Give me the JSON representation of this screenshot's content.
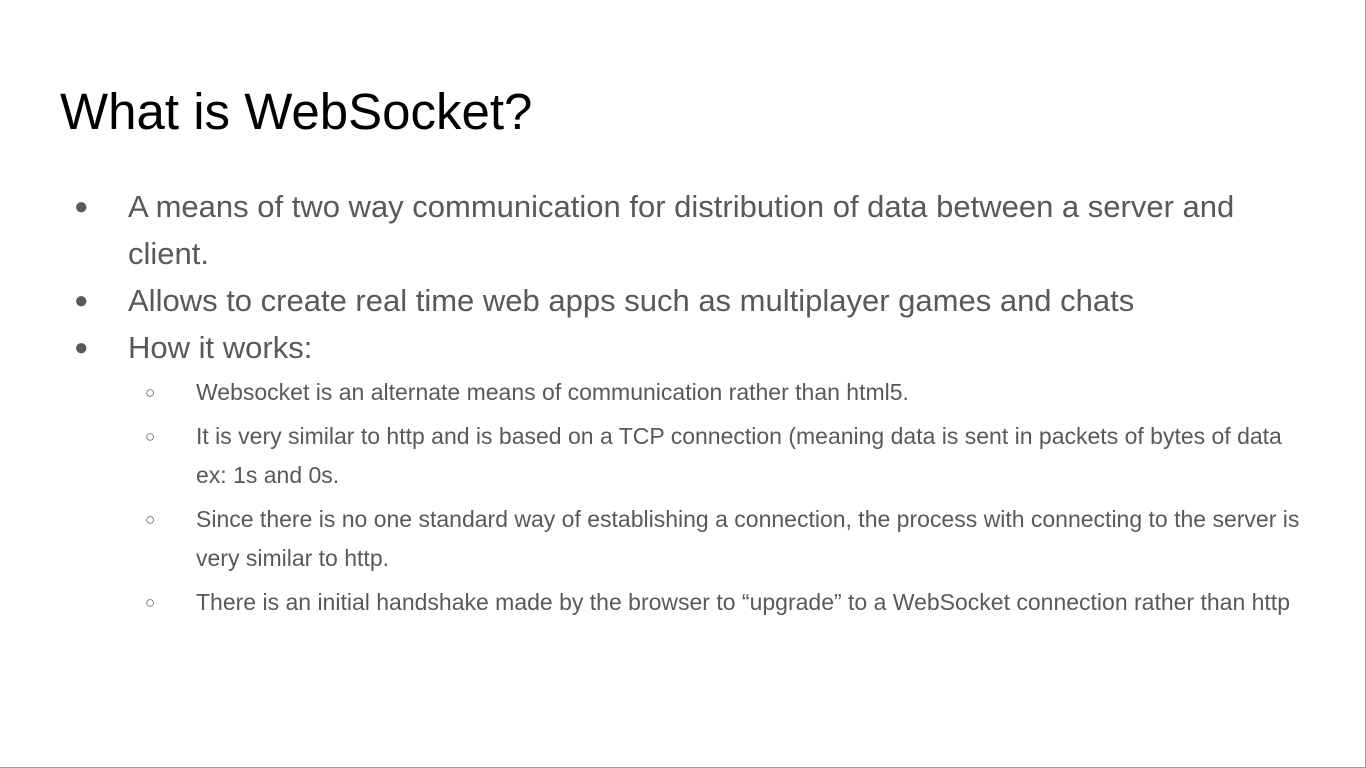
{
  "slide": {
    "title": "What is WebSocket?",
    "bullet_symbol": "●",
    "sub_bullet_symbol": "○",
    "bullets": [
      {
        "text": "A means of two way communication for distribution of data between a server and client."
      },
      {
        "text": "Allows to create real time web apps such as multiplayer games and chats"
      },
      {
        "text": "How it works:"
      }
    ],
    "sub_bullets": [
      {
        "text": "Websocket is an alternate means of communication rather than html5."
      },
      {
        "text": "It is very similar to http and is based on a TCP connection (meaning data is sent in packets of bytes of data ex: 1s and 0s."
      },
      {
        "text": "Since there is no one standard way of establishing a connection, the process with connecting to the server is very similar to http."
      },
      {
        "text": "There is an initial handshake made by the browser to “upgrade” to a WebSocket connection rather than http"
      }
    ]
  }
}
